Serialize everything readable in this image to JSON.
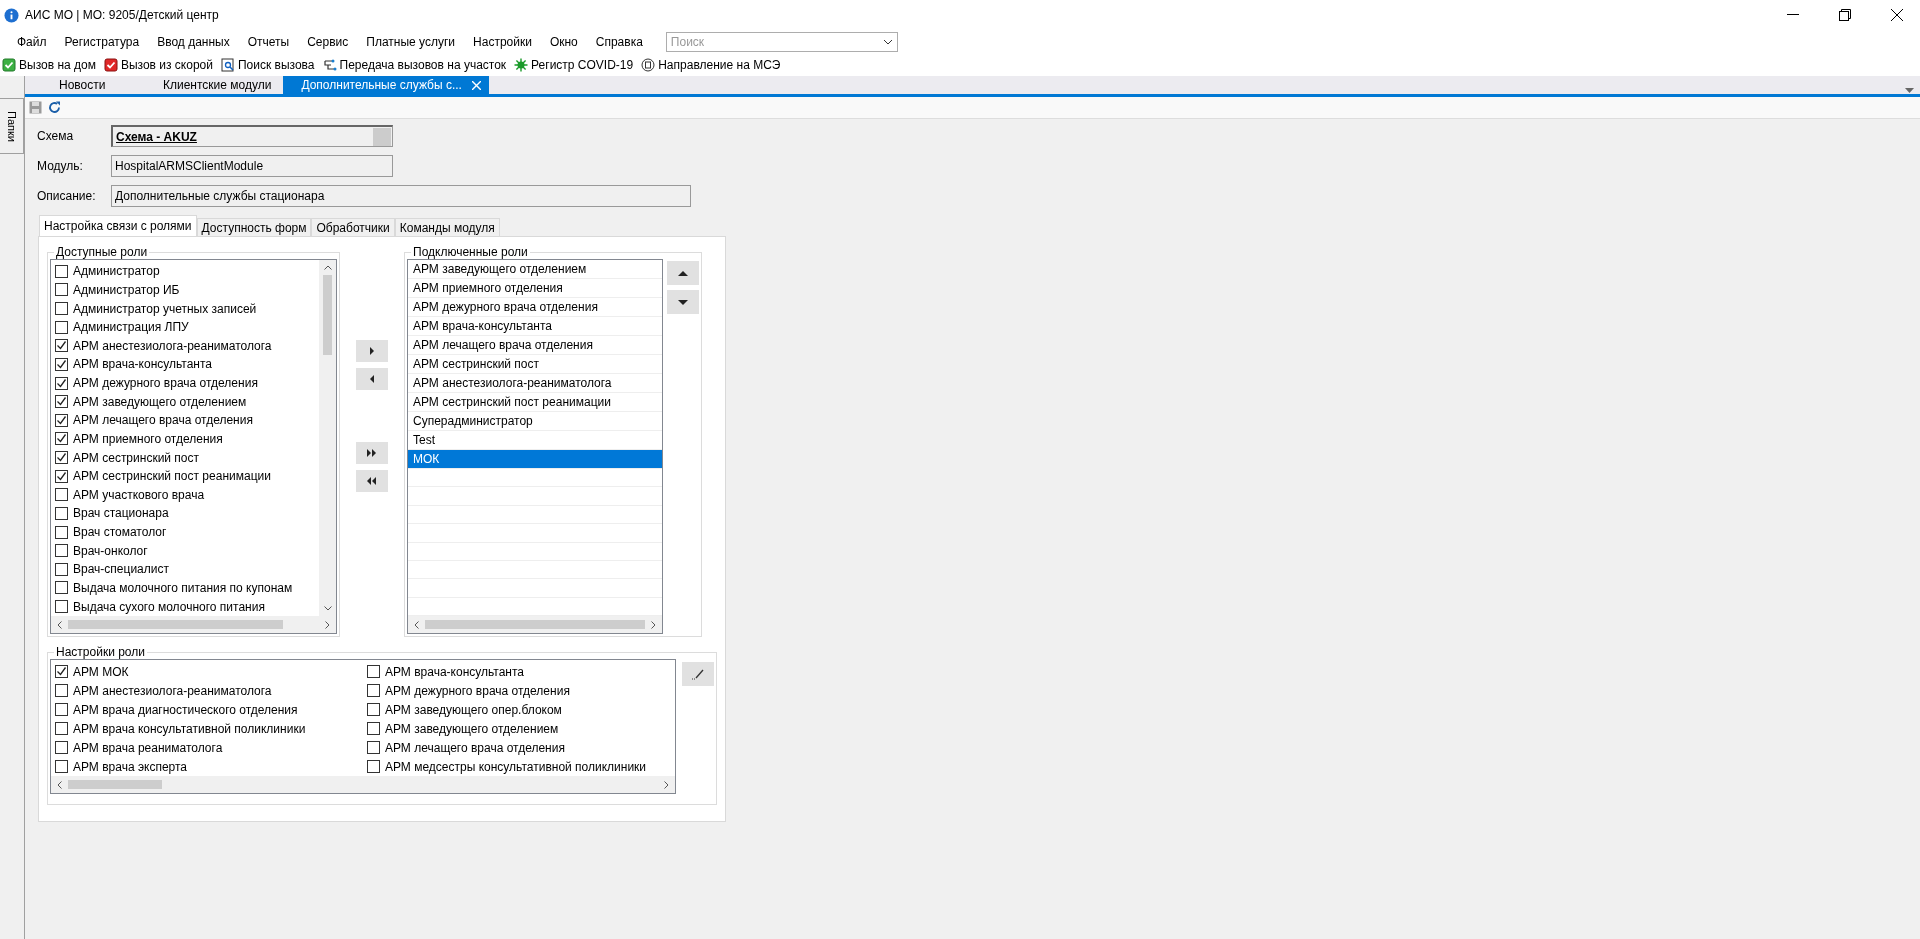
{
  "window": {
    "title": "АИС МО | МО: 9205/Детский центр"
  },
  "menu": [
    "Файл",
    "Регистратура",
    "Ввод данных",
    "Отчеты",
    "Сервис",
    "Платные услуги",
    "Настройки",
    "Окно",
    "Справка"
  ],
  "search": {
    "placeholder": "Поиск"
  },
  "toolbar": [
    {
      "label": "Вызов на дом",
      "kind": "home"
    },
    {
      "label": "Вызов из скорой",
      "kind": "ambulance"
    },
    {
      "label": "Поиск вызова",
      "kind": "search"
    },
    {
      "label": "Передача вызовов на участок",
      "kind": "transfer"
    },
    {
      "label": "Регистр COVID-19",
      "kind": "virus"
    },
    {
      "label": "Направление на МСЭ",
      "kind": "referral"
    }
  ],
  "sidebar": {
    "label": "Папки"
  },
  "doc_tabs": [
    {
      "label": "Новости",
      "selected": false
    },
    {
      "label": "Клиентские модули",
      "selected": false
    },
    {
      "label": "Дополнительные службы с...",
      "selected": true
    }
  ],
  "form": {
    "fields": [
      {
        "label": "Схема",
        "value": "Схема - AKUZ",
        "kind": "lookup"
      },
      {
        "label": "Модуль:",
        "value": "HospitalARMSClientModule",
        "kind": "text"
      },
      {
        "label": "Описание:",
        "value": "Дополнительные службы стационара",
        "kind": "wide"
      }
    ]
  },
  "tabs": [
    {
      "label": "Настройка связи с ролями",
      "selected": true
    },
    {
      "label": "Доступность форм",
      "selected": false
    },
    {
      "label": "Обработчики",
      "selected": false
    },
    {
      "label": "Команды модуля",
      "selected": false
    }
  ],
  "available_roles": {
    "title": "Доступные роли",
    "items": [
      {
        "label": "Администратор",
        "checked": false
      },
      {
        "label": "Администратор ИБ",
        "checked": false
      },
      {
        "label": "Администратор учетных записей",
        "checked": false
      },
      {
        "label": "Администрация ЛПУ",
        "checked": false
      },
      {
        "label": "АРМ анестезиолога-реаниматолога",
        "checked": true
      },
      {
        "label": "АРМ врача-консультанта",
        "checked": true
      },
      {
        "label": "АРМ дежурного врача отделения",
        "checked": true
      },
      {
        "label": "АРМ заведующего отделением",
        "checked": true
      },
      {
        "label": "АРМ лечащего врача отделения",
        "checked": true
      },
      {
        "label": "АРМ приемного отделения",
        "checked": true
      },
      {
        "label": "АРМ сестринский пост",
        "checked": true
      },
      {
        "label": "АРМ сестринский пост реанимации",
        "checked": true
      },
      {
        "label": "АРМ участкового врача",
        "checked": false
      },
      {
        "label": "Врач стационара",
        "checked": false
      },
      {
        "label": "Врач стоматолог",
        "checked": false
      },
      {
        "label": "Врач-онколог",
        "checked": false
      },
      {
        "label": "Врач-специалист",
        "checked": false
      },
      {
        "label": "Выдача молочного питания по купонам",
        "checked": false
      },
      {
        "label": "Выдача сухого молочного питания",
        "checked": false
      }
    ]
  },
  "connected_roles": {
    "title": "Подключенные роли",
    "items": [
      {
        "label": "АРМ заведующего отделением",
        "selected": false
      },
      {
        "label": "АРМ приемного отделения",
        "selected": false
      },
      {
        "label": "АРМ дежурного врача отделения",
        "selected": false
      },
      {
        "label": "АРМ врача-консультанта",
        "selected": false
      },
      {
        "label": "АРМ лечащего врача отделения",
        "selected": false
      },
      {
        "label": "АРМ сестринский пост",
        "selected": false
      },
      {
        "label": "АРМ анестезиолога-реаниматолога",
        "selected": false
      },
      {
        "label": "АРМ сестринский пост реанимации",
        "selected": false
      },
      {
        "label": "Суперадминистратор",
        "selected": false
      },
      {
        "label": "Test",
        "selected": false
      },
      {
        "label": "МОК",
        "selected": true
      }
    ]
  },
  "role_settings": {
    "title": "Настройки роли",
    "items": [
      {
        "label": "АРМ МОК",
        "checked": true
      },
      {
        "label": "АРМ анестезиолога-реаниматолога",
        "checked": false
      },
      {
        "label": "АРМ врача диагностического отделения",
        "checked": false
      },
      {
        "label": "АРМ врача консультативной поликлиники",
        "checked": false
      },
      {
        "label": "АРМ врача реаниматолога",
        "checked": false
      },
      {
        "label": "АРМ врача эксперта",
        "checked": false
      },
      {
        "label": "АРМ врача-консультанта",
        "checked": false
      },
      {
        "label": "АРМ дежурного врача отделения",
        "checked": false
      },
      {
        "label": "АРМ заведующего опер.блоком",
        "checked": false
      },
      {
        "label": "АРМ заведующего отделением",
        "checked": false
      },
      {
        "label": "АРМ лечащего врача отделения",
        "checked": false
      },
      {
        "label": "АРМ медсестры консультативной поликлиники",
        "checked": false
      }
    ]
  }
}
